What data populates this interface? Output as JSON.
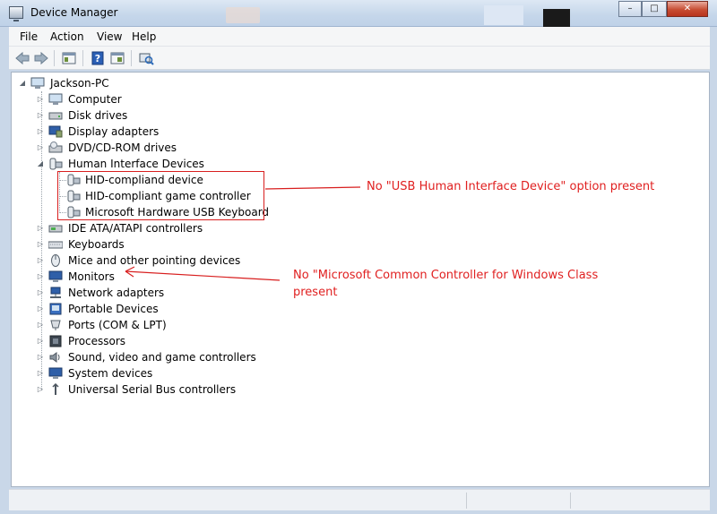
{
  "window": {
    "title": "Device Manager",
    "min_glyph": "–",
    "max_glyph": "□",
    "close_glyph": "✕"
  },
  "menu": {
    "file": "File",
    "action": "Action",
    "view": "View",
    "help": "Help"
  },
  "toolbar": {
    "icons": [
      "back-arrow-icon",
      "forward-arrow-icon",
      "show-hide-console-tree-icon",
      "help-icon",
      "properties-icon",
      "scan-hardware-icon"
    ]
  },
  "tree": {
    "root": "Jackson-PC",
    "categories": [
      "Computer",
      "Disk drives",
      "Display adapters",
      "DVD/CD-ROM drives",
      "Human Interface Devices",
      "IDE ATA/ATAPI controllers",
      "Keyboards",
      "Mice and other pointing devices",
      "Monitors",
      "Network adapters",
      "Portable Devices",
      "Ports (COM & LPT)",
      "Processors",
      "Sound, video and game controllers",
      "System devices",
      "Universal Serial Bus controllers"
    ],
    "hid_children": [
      "HID-compliand device",
      "HID-compliant game controller",
      "Microsoft Hardware USB Keyboard"
    ]
  },
  "annotations": {
    "note_1": "No \"USB Human Interface Device\" option present",
    "note_2_line1": "No \"Microsoft Common Controller for Windows Class",
    "note_2_line2": "present",
    "color": "#e02020"
  }
}
